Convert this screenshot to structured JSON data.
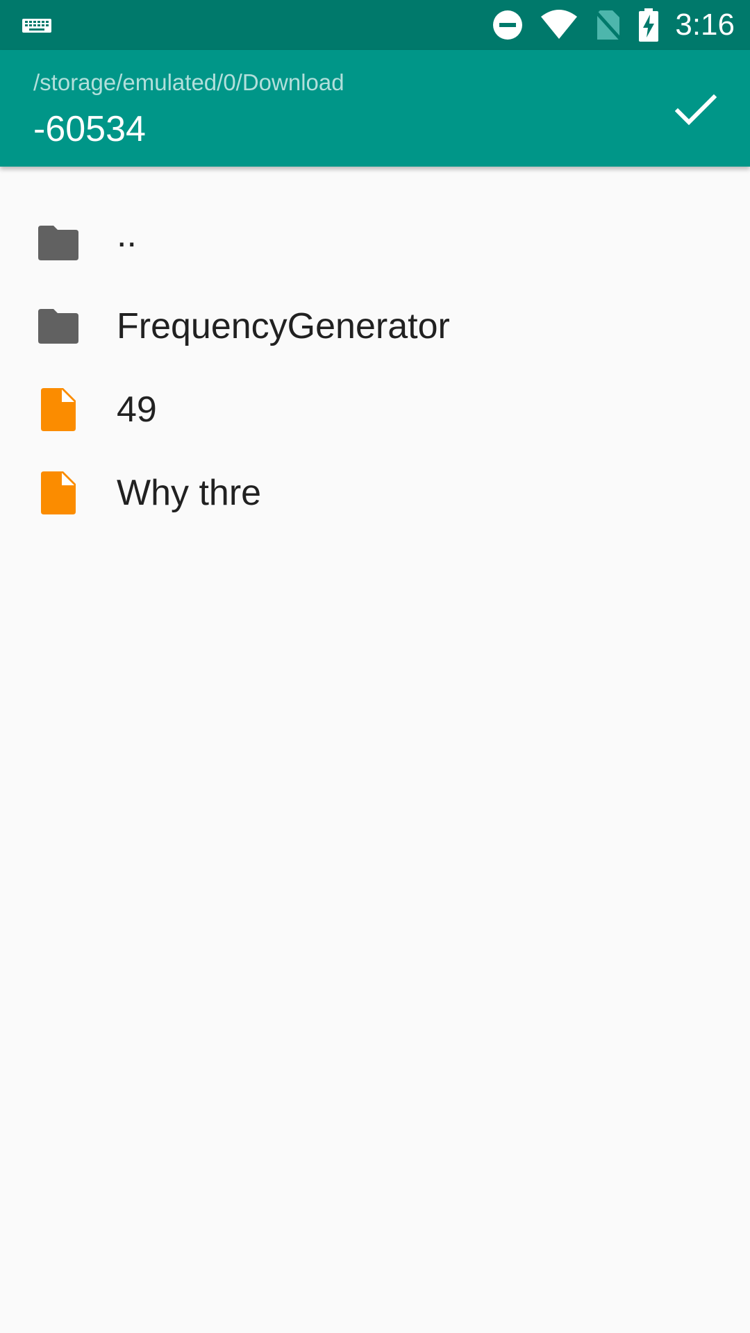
{
  "status_bar": {
    "time": "3:16",
    "icons": [
      "keyboard-icon",
      "do-not-disturb-icon",
      "wifi-icon",
      "no-sim-icon",
      "battery-charging-icon"
    ]
  },
  "toolbar": {
    "path": "/storage/emulated/0/Download",
    "filename_value": "-60534",
    "confirm_icon": "check-icon"
  },
  "files": [
    {
      "name": "..",
      "type": "folder",
      "icon": "folder-icon"
    },
    {
      "name": "FrequencyGenerator",
      "type": "folder",
      "icon": "folder-icon"
    },
    {
      "name": "49",
      "type": "file",
      "icon": "file-icon"
    },
    {
      "name": "Why thre",
      "type": "file",
      "icon": "file-icon"
    }
  ],
  "colors": {
    "status_bar": "#00796b",
    "toolbar": "#009688",
    "folder_icon": "#616161",
    "file_icon": "#fb8c00",
    "background": "#fafafa"
  }
}
